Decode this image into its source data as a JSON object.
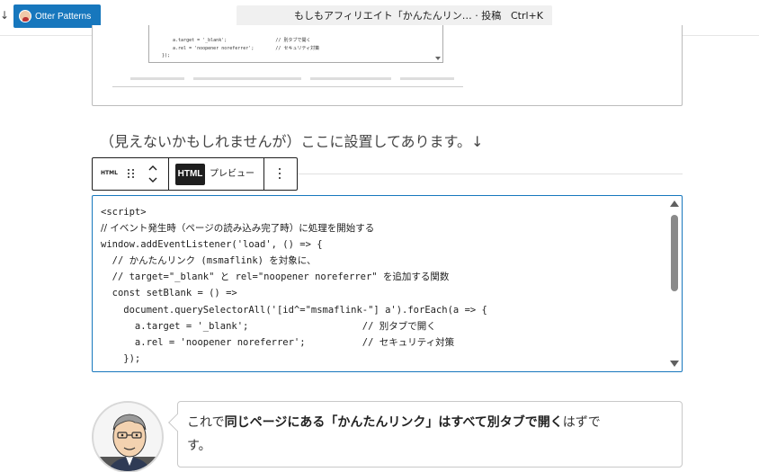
{
  "topbar": {
    "edge_glyph": "↓",
    "site_name": "Otter Patterns",
    "command_title": "もしもアフィリエイト「かんたんリン…  · 投稿",
    "command_shortcut": "Ctrl+K"
  },
  "preview": {
    "lines": [
      "  a.target = '_blank';                  // 別タブで開く",
      "  a.rel = 'noopener noreferrer';        // セキュリティ対策",
      "});"
    ]
  },
  "heading_text": "（見えないかもしれませんが）ここに設置してあります。↓",
  "toolbar": {
    "block_icon_label": "HTML",
    "html_tab": "HTML",
    "preview_tab": "プレビュー"
  },
  "code": {
    "lines": [
      "<script>",
      "// イベント発生時（ページの読み込み完了時）に処理を開始する",
      "window.addEventListener('load', () => {",
      "  // かんたんリンク (msmaflink) を対象に、",
      "  // target=\"_blank\" と rel=\"noopener noreferrer\" を追加する関数",
      "  const setBlank = () =>",
      "    document.querySelectorAll('[id^=\"msmaflink-\"] a').forEach(a => {",
      "      a.target = '_blank';                    // 別タブで開く",
      "      a.rel = 'noopener noreferrer';          // セキュリティ対策",
      "    });"
    ]
  },
  "balloon": {
    "t1": "これで",
    "t2": "同じページにある「かんたんリンク」はすべて別タブで開く",
    "t3": "はずで",
    "t4": "す。"
  },
  "colors": {
    "accent": "#1777bd",
    "spellcheck": "#d33"
  }
}
